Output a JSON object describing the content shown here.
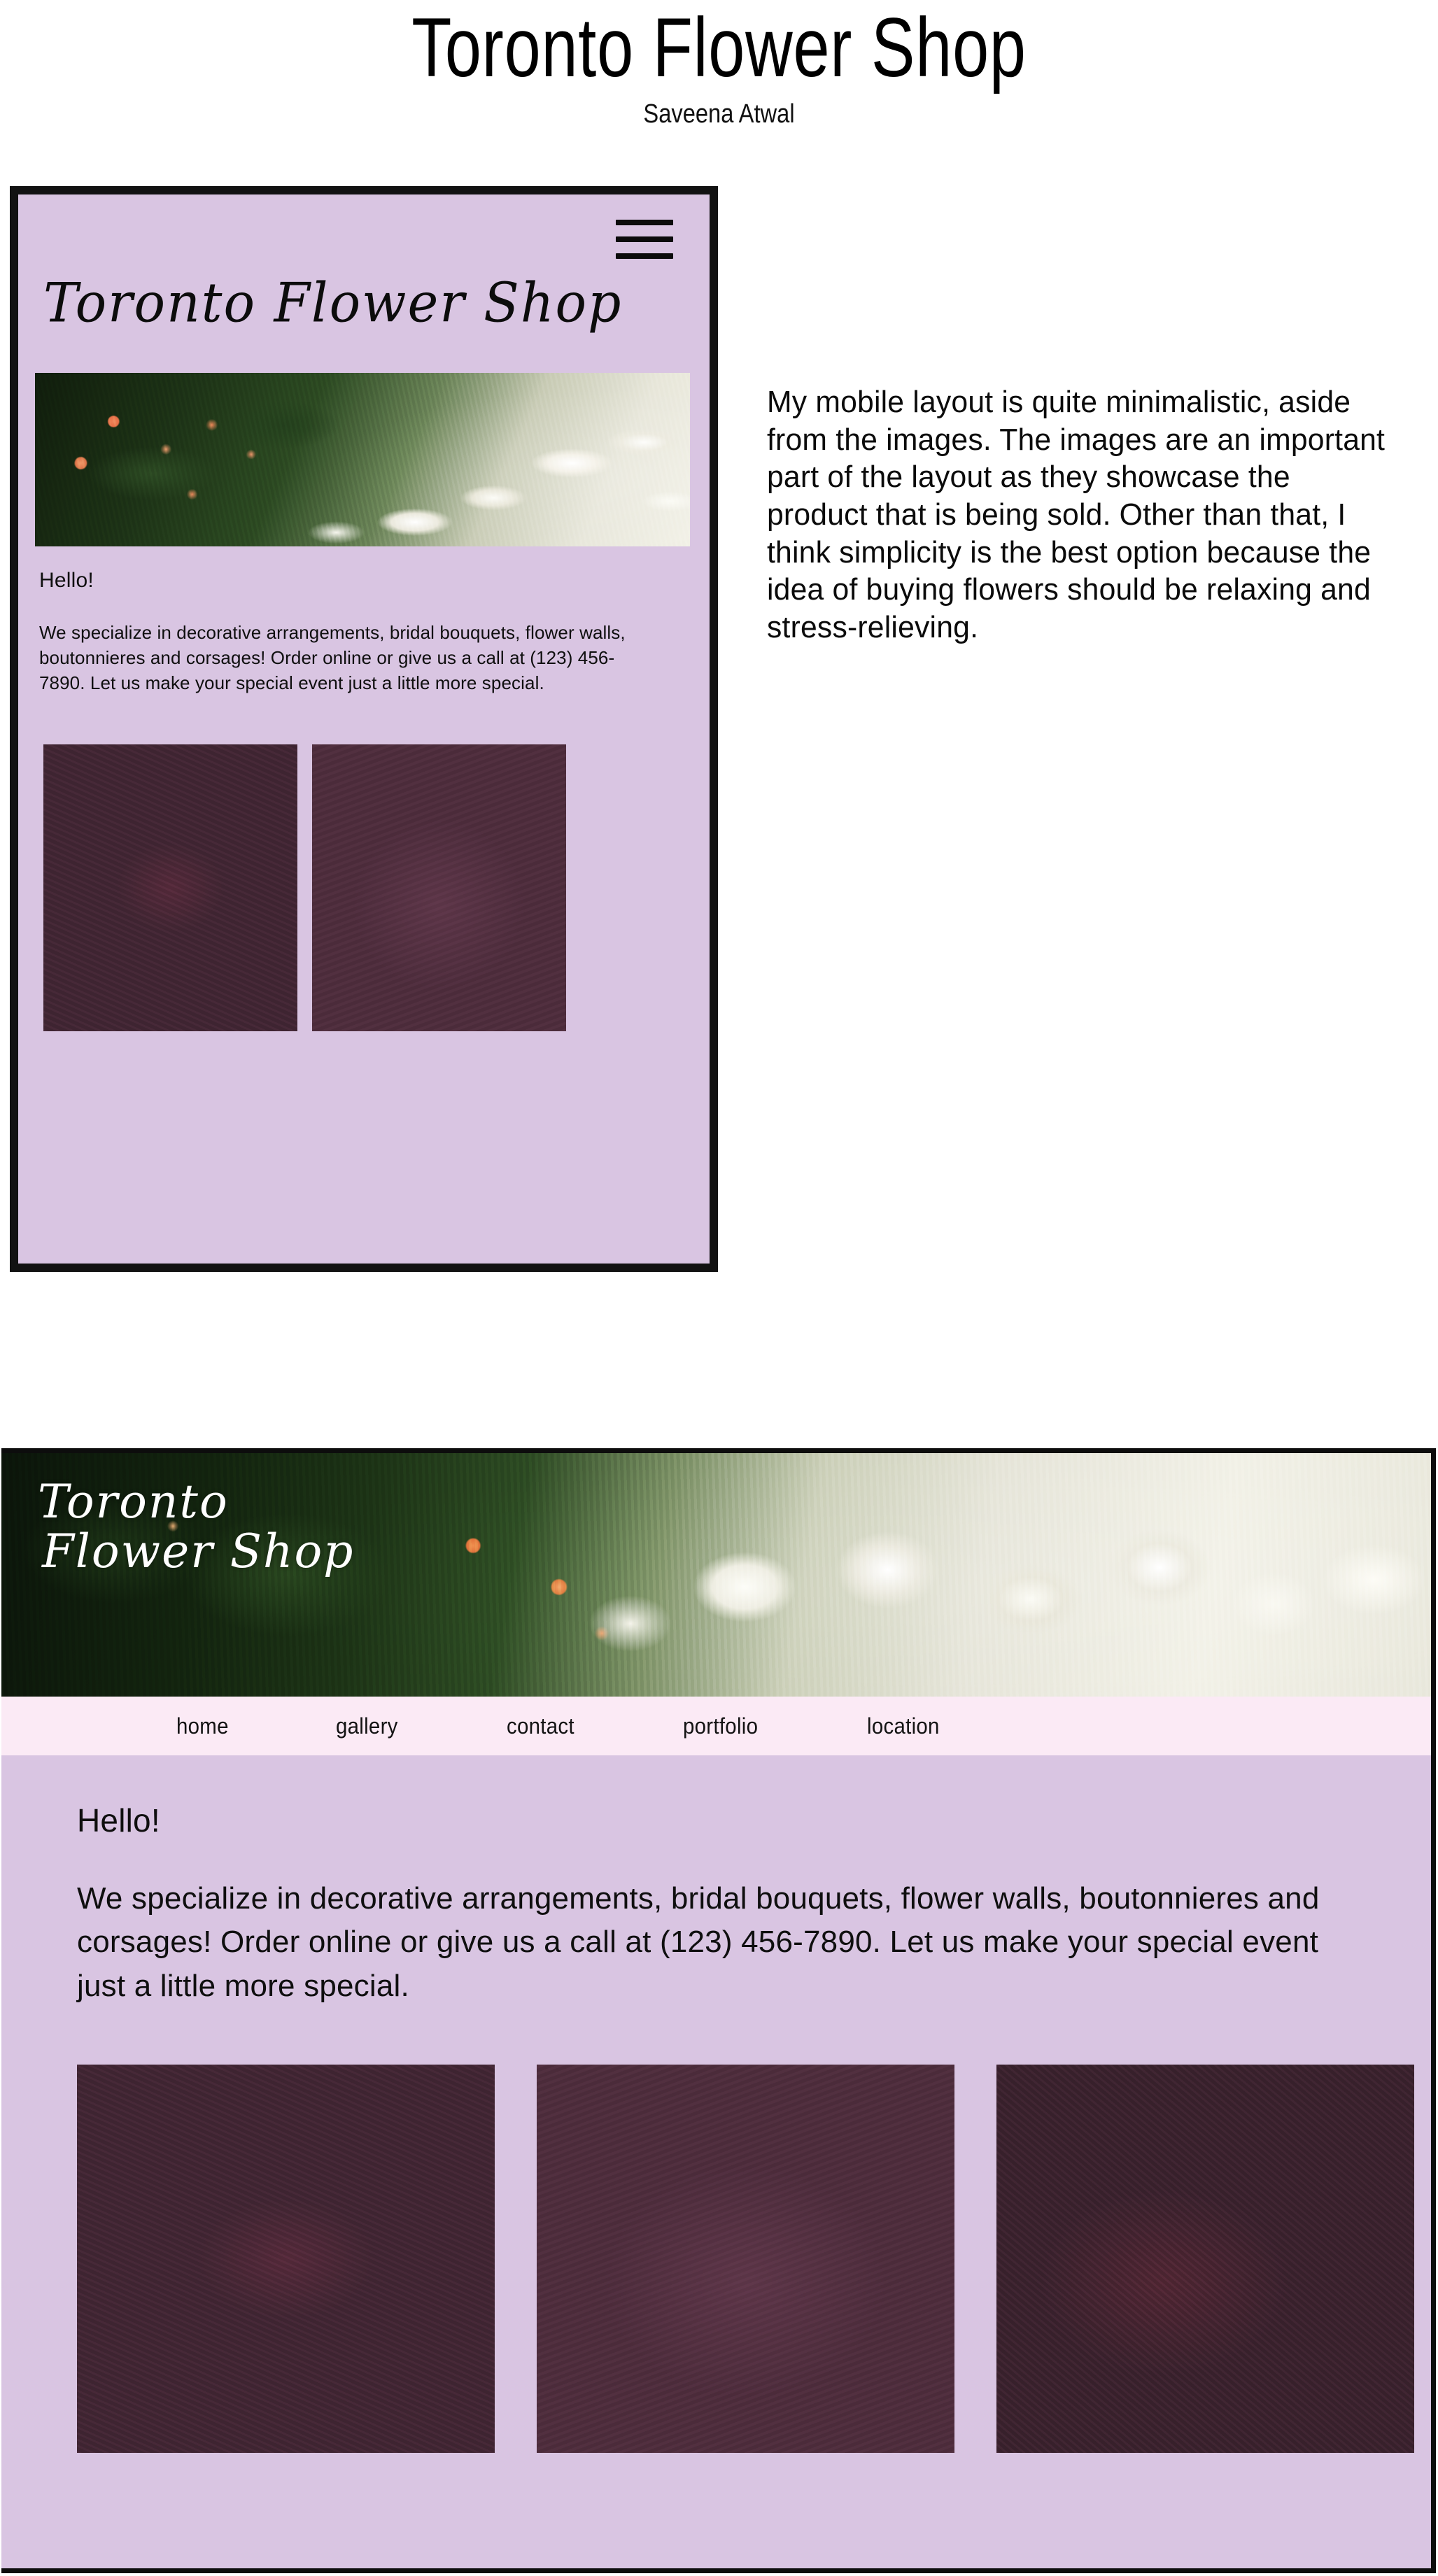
{
  "page": {
    "title": "Toronto Flower Shop",
    "author": "Saveena Atwal"
  },
  "annotation": {
    "text": "My mobile layout is quite minimalistic, aside from the images. The images are an important part of the layout as they showcase the product that is being sold. Other than that, I think simplicity is the best option because the idea of buying flowers should be relaxing and stress-relieving."
  },
  "mobile": {
    "logo": "Toronto Flower Shop",
    "menu_icon": "hamburger-menu-icon",
    "hero_image": "white-alstroemeria-and-orange-berries-photo",
    "greeting": "Hello!",
    "body": "We specialize in decorative arrangements, bridal bouquets, flower walls, boutonnieres and corsages! Order online or give us a call at (123) 456-7890. Let us make your special event just a little more special.",
    "gallery": [
      {
        "name": "burgundy-bouquet-photo"
      },
      {
        "name": "blush-rose-bouquet-photo"
      }
    ],
    "frame_color": "#121212",
    "background_color": "#d9c5e2"
  },
  "desktop": {
    "logo_line1": "Toronto",
    "logo_line2": "Flower Shop",
    "hero_image": "white-alstroemeria-banner-photo",
    "nav": [
      {
        "label": "home"
      },
      {
        "label": "gallery"
      },
      {
        "label": "contact"
      },
      {
        "label": "portfolio"
      },
      {
        "label": "location"
      }
    ],
    "greeting": "Hello!",
    "body": "We specialize in decorative arrangements, bridal bouquets, flower walls, boutonnieres and corsages! Order online or give us a call at (123) 456-7890. Let us make your special event just a little more special.",
    "gallery": [
      {
        "name": "burgundy-bouquet-photo"
      },
      {
        "name": "blush-rose-bouquet-photo"
      },
      {
        "name": "red-rose-bouquet-photo"
      }
    ],
    "nav_background_color": "#fbeaf5",
    "background_color": "#d9c5e2",
    "frame_color": "#0d0d0d"
  }
}
